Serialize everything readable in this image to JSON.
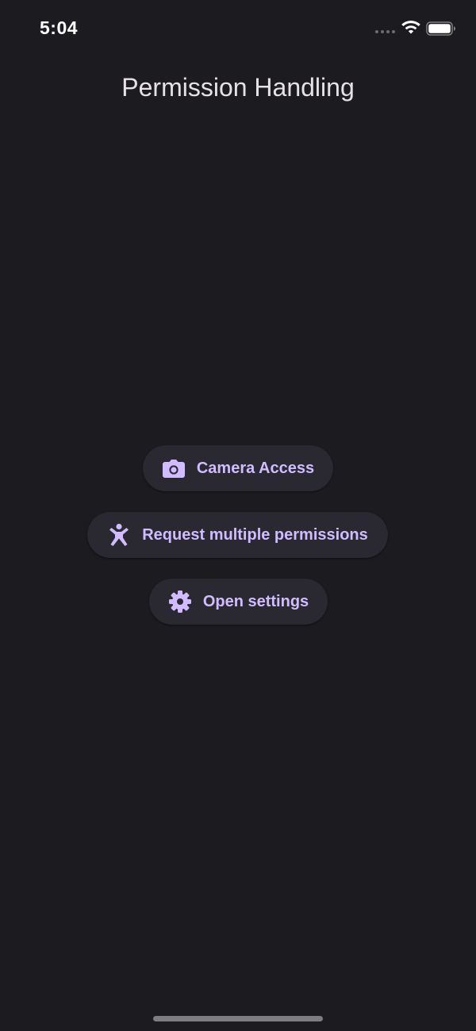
{
  "status_bar": {
    "time": "5:04"
  },
  "header": {
    "title": "Permission Handling"
  },
  "actions": [
    {
      "label": "Camera Access",
      "icon": "camera-icon"
    },
    {
      "label": "Request multiple permissions",
      "icon": "accessibility-icon"
    },
    {
      "label": "Open settings",
      "icon": "gear-icon"
    }
  ],
  "colors": {
    "background": "#1c1b1f",
    "button_background": "#2a2830",
    "accent": "#d0bcff",
    "title_text": "#e6e1e5"
  }
}
